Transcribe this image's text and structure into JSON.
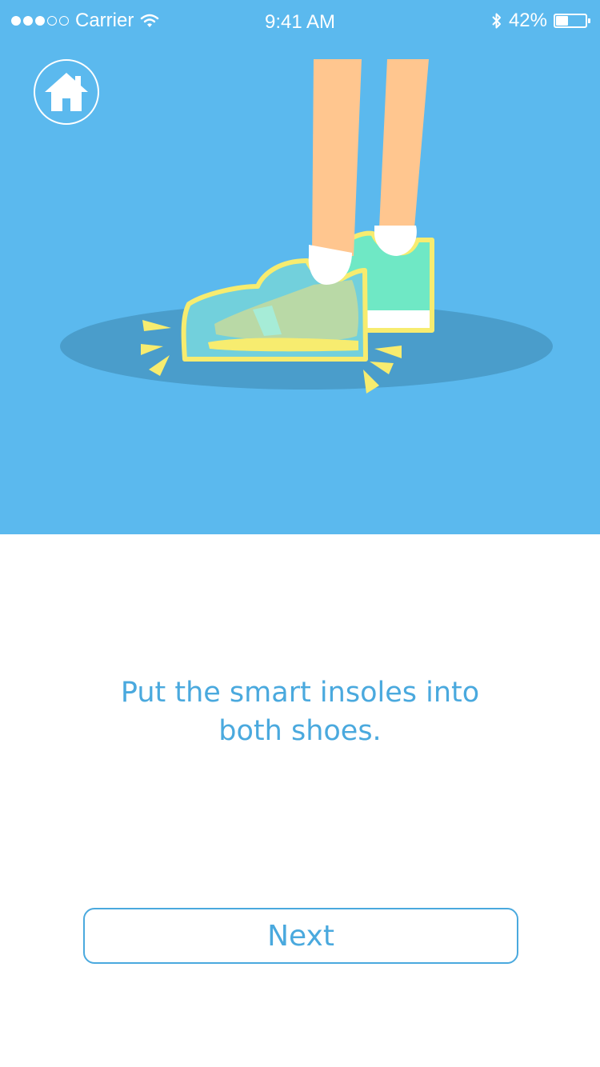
{
  "status_bar": {
    "carrier": "Carrier",
    "time": "9:41 AM",
    "battery_percent": "42%",
    "battery_level": 0.42,
    "signal_bars_filled": 3,
    "signal_bars_total": 5,
    "icons": [
      "signal-dots-icon",
      "wifi-icon",
      "bluetooth-icon",
      "battery-icon"
    ]
  },
  "hero": {
    "background_color": "#5bb9ee",
    "home_icon": "home-icon"
  },
  "instruction": {
    "line1": "Put the smart insoles into",
    "line2": "both shoes."
  },
  "next_button": {
    "label": "Next"
  },
  "colors": {
    "accent": "#4aa9de",
    "skin": "#ffc68f",
    "shoe_back": "#6fe8c5",
    "shoe_front": "#72d0dc",
    "outline": "#f7ec6f",
    "shadow": "#4a9dcb"
  }
}
